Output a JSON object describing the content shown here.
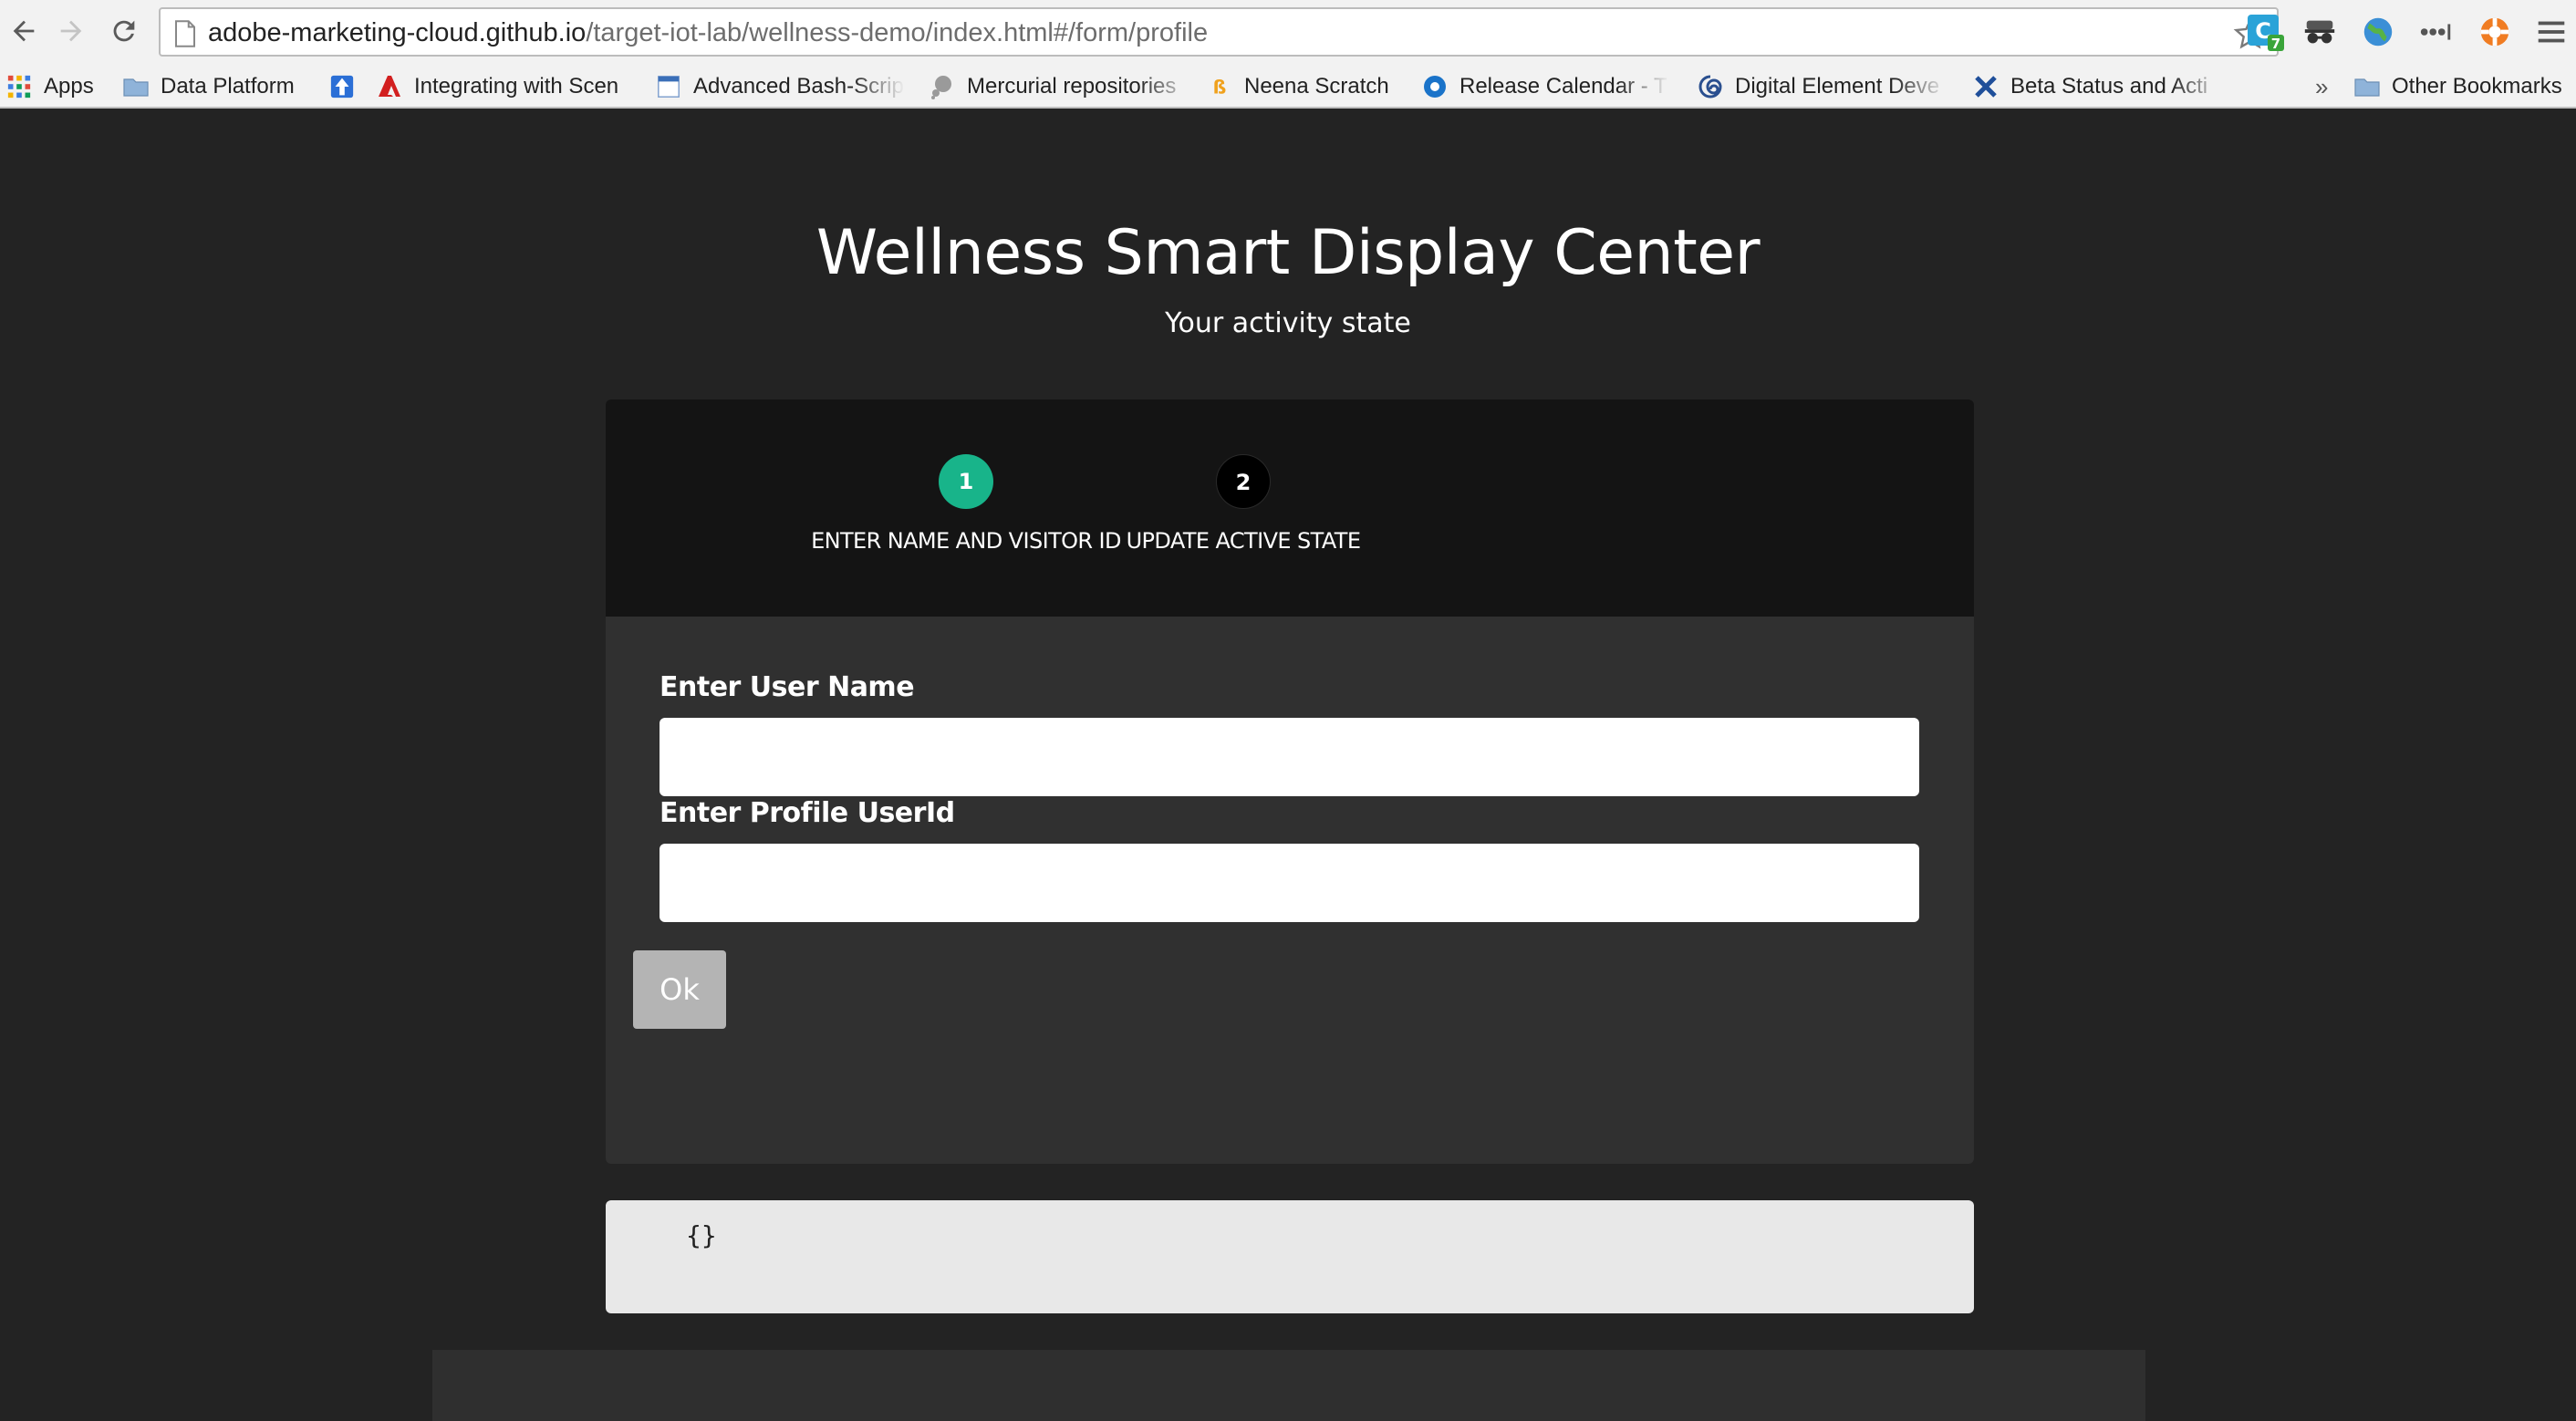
{
  "browser": {
    "url_host": "adobe-marketing-cloud.github.io",
    "url_path": "/target-iot-lab/wellness-demo/index.html#/form/profile",
    "extensions": [
      {
        "icon": "clearly-icon",
        "badge": "7"
      },
      {
        "icon": "incognito-glasses-icon"
      },
      {
        "icon": "globe-icon"
      },
      {
        "icon": "lastpass-dots-icon"
      },
      {
        "icon": "lifebuoy-icon"
      }
    ],
    "bookmarks": [
      {
        "label": "Apps",
        "icon": "apps-grid-icon"
      },
      {
        "label": "Data Platform",
        "icon": "folder-icon"
      },
      {
        "label": "",
        "icon": "arrow-up-icon"
      },
      {
        "label": "Integrating with Scen",
        "icon": "adobe-icon"
      },
      {
        "label": "Advanced Bash-Scrip",
        "icon": "page-icon"
      },
      {
        "label": "Mercurial repositories",
        "icon": "mercurial-icon"
      },
      {
        "label": "Neena Scratch",
        "icon": "bitcoin-icon"
      },
      {
        "label": "Release Calendar - T",
        "icon": "circle-icon"
      },
      {
        "label": "Digital Element Deve",
        "icon": "swirl-icon"
      },
      {
        "label": "Beta Status and Acti",
        "icon": "cross-tools-icon"
      },
      {
        "label": "»",
        "icon": ""
      },
      {
        "label": "Other Bookmarks",
        "icon": "folder-icon"
      }
    ]
  },
  "header": {
    "title": "Wellness Smart Display Center",
    "subtitle": "Your activity state"
  },
  "steps": [
    {
      "number": "1",
      "label": "ENTER NAME AND VISITOR ID",
      "active": true
    },
    {
      "number": "2",
      "label": "UPDATE ACTIVE STATE",
      "active": false
    }
  ],
  "form": {
    "username_label": "Enter User Name",
    "username_value": "",
    "userid_label": "Enter Profile UserId",
    "userid_value": "",
    "ok_label": "Ok"
  },
  "output": {
    "json_text": "{}"
  },
  "colors": {
    "background": "#232323",
    "card": "#303030",
    "card_header": "#141414",
    "step_active": "#18b48a",
    "button_disabled": "#b4b4b4"
  }
}
